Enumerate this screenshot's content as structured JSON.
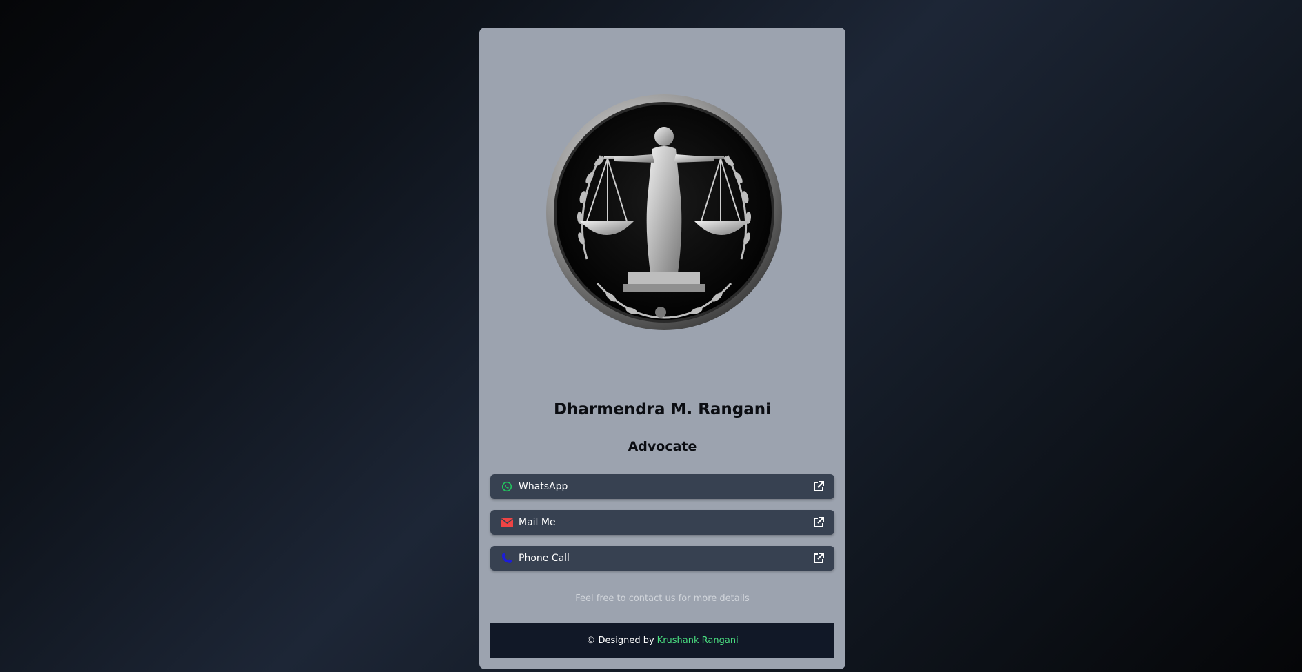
{
  "profile": {
    "name": "Dharmendra M. Rangani",
    "role": "Advocate",
    "emblem": "scales-of-justice-emblem"
  },
  "links": [
    {
      "label": "WhatsApp",
      "icon": "whatsapp-icon",
      "icon_color": "#22c55e"
    },
    {
      "label": "Mail Me",
      "icon": "mail-icon",
      "icon_color": "#ef4444"
    },
    {
      "label": "Phone Call",
      "icon": "phone-icon",
      "icon_color": "#1d1dd8"
    }
  ],
  "note": "Feel free to contact us for more details",
  "footer": {
    "prefix": "© Designed by",
    "author": "Krushank Rangani",
    "author_color": "#4ade80"
  },
  "colors": {
    "card": "#9ca3af",
    "button": "#374151",
    "footer": "#111827"
  }
}
